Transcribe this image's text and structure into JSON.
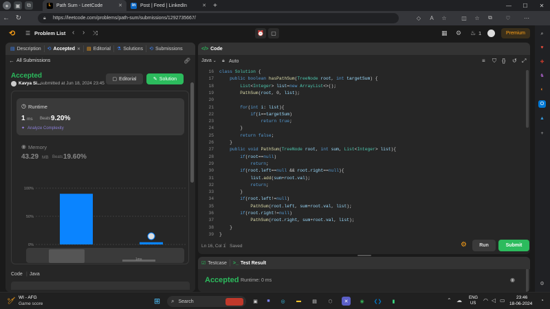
{
  "browser": {
    "tabs": [
      {
        "title": "Path Sum - LeetCode",
        "icon": "leetcode-icon",
        "active": true
      },
      {
        "title": "Post | Feed | LinkedIn",
        "icon": "linkedin-icon",
        "active": false
      }
    ],
    "new_tab": "+",
    "url": "https://leetcode.com/problems/path-sum/submissions/1292735667/"
  },
  "header": {
    "problem_list": "Problem List",
    "streak_count": "1",
    "premium": "Premium"
  },
  "left_panel": {
    "tabs": [
      {
        "label": "Description",
        "icon": "description-icon"
      },
      {
        "label": "Accepted",
        "icon": "accepted-icon",
        "close": "✕"
      },
      {
        "label": "Editorial",
        "icon": "editorial-icon"
      },
      {
        "label": "Solutions",
        "icon": "solutions-icon"
      },
      {
        "label": "Submissions",
        "icon": "submissions-icon"
      }
    ],
    "all_submissions": "All Submissions",
    "status": "Accepted",
    "user": "Kavya Si...",
    "submitted": "submitted at Jun 18, 2024 23:45",
    "editorial_btn": "Editorial",
    "solution_btn": "Solution",
    "runtime": {
      "label": "Runtime",
      "value": "1",
      "unit": "ms",
      "beats_label": "Beats",
      "beats": "9.20%",
      "analyze": "Analyze Complexity"
    },
    "memory": {
      "label": "Memory",
      "value": "43.29",
      "unit": "MB",
      "beats_label": "Beats",
      "beats": "19.60%"
    },
    "footer": {
      "code": "Code",
      "lang": "Java"
    }
  },
  "chart_data": {
    "type": "bar",
    "yticks": [
      "100%",
      "50%",
      "0%"
    ],
    "ylim": [
      0,
      100
    ],
    "categories": [
      "",
      "1ms"
    ],
    "values": [
      90,
      4
    ],
    "mini_label": "1ms"
  },
  "code_panel": {
    "title": "Code",
    "language": "Java",
    "mode": "Auto",
    "status": "Ln 16, Col 1",
    "saved": "Saved",
    "run": "Run",
    "submit": "Submit",
    "lines": [
      {
        "n": "16",
        "code": "class Solution {"
      },
      {
        "n": "17",
        "code": "    public boolean hasPathSum(TreeNode root, int targetSum) {"
      },
      {
        "n": "18",
        "code": "        List<Integer> list=new ArrayList<>();"
      },
      {
        "n": "19",
        "code": "        PathSum(root, 0, list);"
      },
      {
        "n": "20",
        "code": ""
      },
      {
        "n": "21",
        "code": "        for(int i: list){"
      },
      {
        "n": "22",
        "code": "            if(i==targetSum)"
      },
      {
        "n": "23",
        "code": "                return true;"
      },
      {
        "n": "24",
        "code": "        }"
      },
      {
        "n": "25",
        "code": "        return false;"
      },
      {
        "n": "26",
        "code": "    }"
      },
      {
        "n": "27",
        "code": "    public void PathSum(TreeNode root, int sum, List<Integer> list){"
      },
      {
        "n": "28",
        "code": "        if(root==null)"
      },
      {
        "n": "29",
        "code": "            return;"
      },
      {
        "n": "30",
        "code": "        if(root.left==null && root.right==null){"
      },
      {
        "n": "31",
        "code": "            list.add(sum+root.val);"
      },
      {
        "n": "32",
        "code": "            return;"
      },
      {
        "n": "33",
        "code": "        }"
      },
      {
        "n": "34",
        "code": "        if(root.left!=null)"
      },
      {
        "n": "35",
        "code": "            PathSum(root.left, sum+root.val, list);"
      },
      {
        "n": "36",
        "code": "        if(root.right!=null)"
      },
      {
        "n": "37",
        "code": "            PathSum(root.right, sum+root.val, list);"
      },
      {
        "n": "38",
        "code": "    }"
      },
      {
        "n": "39",
        "code": "}"
      }
    ]
  },
  "result_panel": {
    "testcase": "Testcase",
    "test_result": "Test Result",
    "accepted": "Accepted",
    "runtime": "Runtime: 0 ms"
  },
  "taskbar": {
    "weather_title": "WI - AFG",
    "weather_sub": "Game score",
    "search": "Search",
    "lang1": "ENG",
    "lang2": "US",
    "time": "23:46",
    "date": "18-06-2024"
  },
  "colors": {
    "accepted_green": "#2cbb5d",
    "blue_bar": "#0a84ff",
    "premium": "#ffa116"
  }
}
